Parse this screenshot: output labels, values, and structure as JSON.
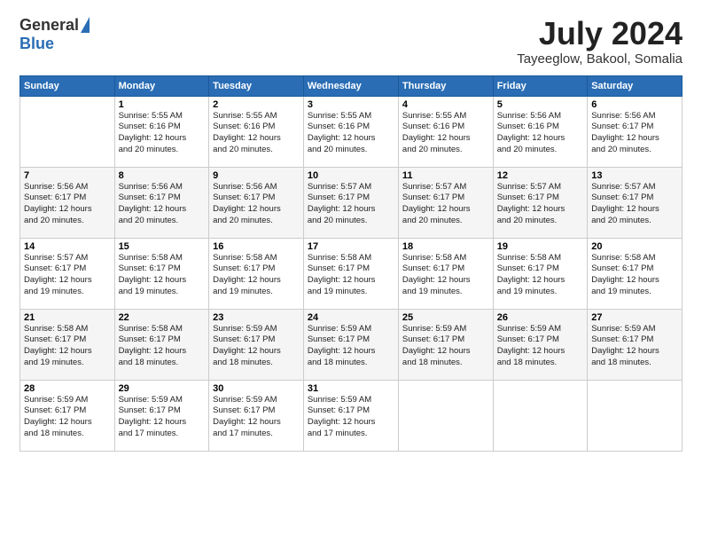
{
  "header": {
    "logo_general": "General",
    "logo_blue": "Blue",
    "main_title": "July 2024",
    "subtitle": "Tayeeglow, Bakool, Somalia"
  },
  "weekdays": [
    "Sunday",
    "Monday",
    "Tuesday",
    "Wednesday",
    "Thursday",
    "Friday",
    "Saturday"
  ],
  "weeks": [
    [
      {
        "day": "",
        "detail": ""
      },
      {
        "day": "1",
        "detail": "Sunrise: 5:55 AM\nSunset: 6:16 PM\nDaylight: 12 hours\nand 20 minutes."
      },
      {
        "day": "2",
        "detail": "Sunrise: 5:55 AM\nSunset: 6:16 PM\nDaylight: 12 hours\nand 20 minutes."
      },
      {
        "day": "3",
        "detail": "Sunrise: 5:55 AM\nSunset: 6:16 PM\nDaylight: 12 hours\nand 20 minutes."
      },
      {
        "day": "4",
        "detail": "Sunrise: 5:55 AM\nSunset: 6:16 PM\nDaylight: 12 hours\nand 20 minutes."
      },
      {
        "day": "5",
        "detail": "Sunrise: 5:56 AM\nSunset: 6:16 PM\nDaylight: 12 hours\nand 20 minutes."
      },
      {
        "day": "6",
        "detail": "Sunrise: 5:56 AM\nSunset: 6:17 PM\nDaylight: 12 hours\nand 20 minutes."
      }
    ],
    [
      {
        "day": "7",
        "detail": "Sunrise: 5:56 AM\nSunset: 6:17 PM\nDaylight: 12 hours\nand 20 minutes."
      },
      {
        "day": "8",
        "detail": "Sunrise: 5:56 AM\nSunset: 6:17 PM\nDaylight: 12 hours\nand 20 minutes."
      },
      {
        "day": "9",
        "detail": "Sunrise: 5:56 AM\nSunset: 6:17 PM\nDaylight: 12 hours\nand 20 minutes."
      },
      {
        "day": "10",
        "detail": "Sunrise: 5:57 AM\nSunset: 6:17 PM\nDaylight: 12 hours\nand 20 minutes."
      },
      {
        "day": "11",
        "detail": "Sunrise: 5:57 AM\nSunset: 6:17 PM\nDaylight: 12 hours\nand 20 minutes."
      },
      {
        "day": "12",
        "detail": "Sunrise: 5:57 AM\nSunset: 6:17 PM\nDaylight: 12 hours\nand 20 minutes."
      },
      {
        "day": "13",
        "detail": "Sunrise: 5:57 AM\nSunset: 6:17 PM\nDaylight: 12 hours\nand 20 minutes."
      }
    ],
    [
      {
        "day": "14",
        "detail": "Sunrise: 5:57 AM\nSunset: 6:17 PM\nDaylight: 12 hours\nand 19 minutes."
      },
      {
        "day": "15",
        "detail": "Sunrise: 5:58 AM\nSunset: 6:17 PM\nDaylight: 12 hours\nand 19 minutes."
      },
      {
        "day": "16",
        "detail": "Sunrise: 5:58 AM\nSunset: 6:17 PM\nDaylight: 12 hours\nand 19 minutes."
      },
      {
        "day": "17",
        "detail": "Sunrise: 5:58 AM\nSunset: 6:17 PM\nDaylight: 12 hours\nand 19 minutes."
      },
      {
        "day": "18",
        "detail": "Sunrise: 5:58 AM\nSunset: 6:17 PM\nDaylight: 12 hours\nand 19 minutes."
      },
      {
        "day": "19",
        "detail": "Sunrise: 5:58 AM\nSunset: 6:17 PM\nDaylight: 12 hours\nand 19 minutes."
      },
      {
        "day": "20",
        "detail": "Sunrise: 5:58 AM\nSunset: 6:17 PM\nDaylight: 12 hours\nand 19 minutes."
      }
    ],
    [
      {
        "day": "21",
        "detail": "Sunrise: 5:58 AM\nSunset: 6:17 PM\nDaylight: 12 hours\nand 19 minutes."
      },
      {
        "day": "22",
        "detail": "Sunrise: 5:58 AM\nSunset: 6:17 PM\nDaylight: 12 hours\nand 18 minutes."
      },
      {
        "day": "23",
        "detail": "Sunrise: 5:59 AM\nSunset: 6:17 PM\nDaylight: 12 hours\nand 18 minutes."
      },
      {
        "day": "24",
        "detail": "Sunrise: 5:59 AM\nSunset: 6:17 PM\nDaylight: 12 hours\nand 18 minutes."
      },
      {
        "day": "25",
        "detail": "Sunrise: 5:59 AM\nSunset: 6:17 PM\nDaylight: 12 hours\nand 18 minutes."
      },
      {
        "day": "26",
        "detail": "Sunrise: 5:59 AM\nSunset: 6:17 PM\nDaylight: 12 hours\nand 18 minutes."
      },
      {
        "day": "27",
        "detail": "Sunrise: 5:59 AM\nSunset: 6:17 PM\nDaylight: 12 hours\nand 18 minutes."
      }
    ],
    [
      {
        "day": "28",
        "detail": "Sunrise: 5:59 AM\nSunset: 6:17 PM\nDaylight: 12 hours\nand 18 minutes."
      },
      {
        "day": "29",
        "detail": "Sunrise: 5:59 AM\nSunset: 6:17 PM\nDaylight: 12 hours\nand 17 minutes."
      },
      {
        "day": "30",
        "detail": "Sunrise: 5:59 AM\nSunset: 6:17 PM\nDaylight: 12 hours\nand 17 minutes."
      },
      {
        "day": "31",
        "detail": "Sunrise: 5:59 AM\nSunset: 6:17 PM\nDaylight: 12 hours\nand 17 minutes."
      },
      {
        "day": "",
        "detail": ""
      },
      {
        "day": "",
        "detail": ""
      },
      {
        "day": "",
        "detail": ""
      }
    ]
  ]
}
